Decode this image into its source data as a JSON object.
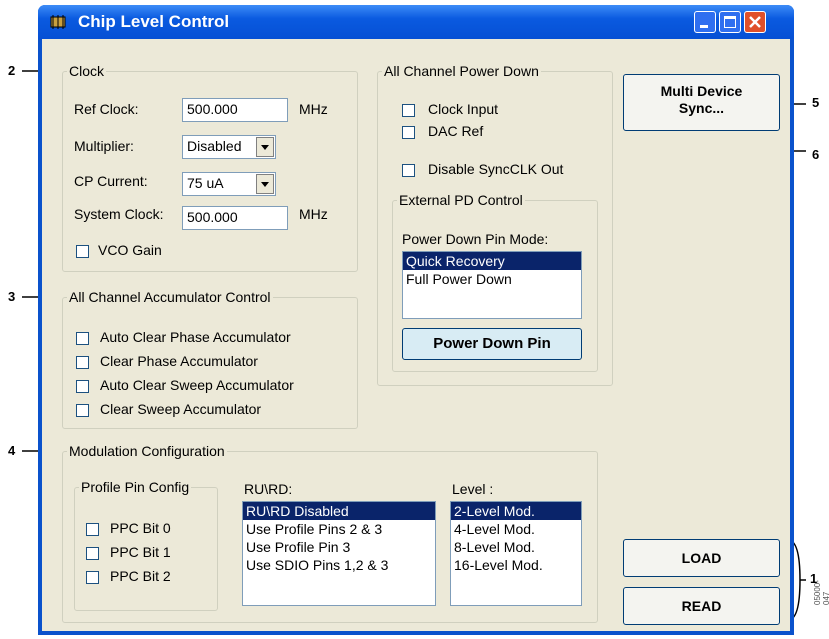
{
  "window": {
    "title": "Chip Level Control"
  },
  "clock": {
    "legend": "Clock",
    "ref_clock_label": "Ref Clock:",
    "ref_clock_value": "500.000",
    "ref_clock_unit": "MHz",
    "multiplier_label": "Multiplier:",
    "multiplier_value": "Disabled",
    "cp_current_label": "CP Current:",
    "cp_current_value": "75 uA",
    "system_clock_label": "System Clock:",
    "system_clock_value": "500.000",
    "system_clock_unit": "MHz",
    "vco_gain_label": "VCO Gain"
  },
  "power_down": {
    "legend": "All Channel Power Down",
    "clock_input_label": "Clock Input",
    "dac_ref_label": "DAC Ref",
    "disable_syncclk_label": "Disable SyncCLK Out",
    "external_legend": "External PD Control",
    "pin_mode_label": "Power Down Pin Mode:",
    "modes": [
      "Quick Recovery",
      "Full Power Down"
    ],
    "pin_button": "Power Down Pin"
  },
  "multi_device": {
    "line1": "Multi Device",
    "line2": "Sync..."
  },
  "accumulator": {
    "legend": "All Channel Accumulator Control",
    "items": [
      "Auto Clear Phase Accumulator",
      "Clear Phase Accumulator",
      "Auto Clear Sweep Accumulator",
      "Clear Sweep Accumulator"
    ]
  },
  "modulation": {
    "legend": "Modulation Configuration",
    "profile_legend": "Profile Pin Config",
    "ppc": [
      "PPC Bit 0",
      "PPC Bit 1",
      "PPC Bit 2"
    ],
    "rurd_label": "RU\\RD:",
    "rurd_items": [
      "RU\\RD Disabled",
      "Use Profile Pins 2 & 3",
      "Use Profile Pin 3",
      "Use SDIO Pins 1,2 & 3"
    ],
    "level_label": "Level :",
    "level_items": [
      "2-Level Mod.",
      "4-Level Mod.",
      "8-Level Mod.",
      "16-Level Mod."
    ]
  },
  "buttons": {
    "load": "LOAD",
    "read": "READ"
  },
  "callouts": [
    "1",
    "2",
    "3",
    "4",
    "5",
    "6"
  ],
  "watermark": "05000-047"
}
